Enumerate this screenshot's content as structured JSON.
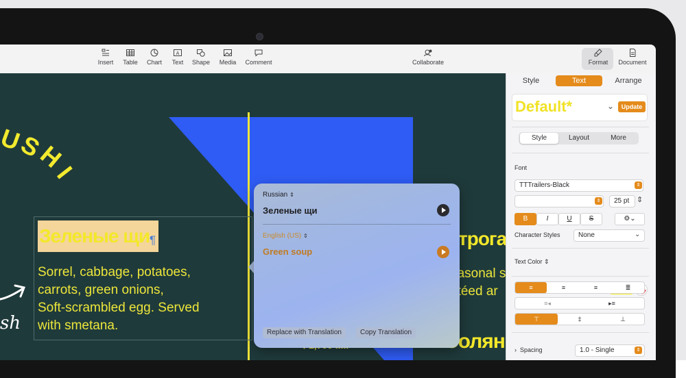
{
  "toolbar": {
    "items": [
      {
        "label": "Insert",
        "icon": "insert-icon"
      },
      {
        "label": "Table",
        "icon": "table-icon"
      },
      {
        "label": "Chart",
        "icon": "chart-icon"
      },
      {
        "label": "Text",
        "icon": "text-icon"
      },
      {
        "label": "Shape",
        "icon": "shape-icon"
      },
      {
        "label": "Media",
        "icon": "media-icon"
      },
      {
        "label": "Comment",
        "icon": "comment-icon"
      }
    ],
    "collaborate": "Collaborate",
    "format": "Format",
    "document": "Document"
  },
  "canvas": {
    "sushi_letters": [
      "U",
      "S",
      "H",
      "I"
    ],
    "heading": "Зеленые щи",
    "pilcrow": "¶",
    "body_lines": [
      "Sorrel, cabbage, potatoes,",
      "carrots, green onions,",
      "Soft-scrambled egg. Served",
      "with smetana."
    ],
    "price": "₽1,700 .....",
    "right_heading": "трога",
    "right_body_lines": [
      "easonal s",
      "utéed ar"
    ],
    "right_heading2": "Солян",
    "script_fragment": "sh",
    "colors": {
      "background": "#1f3a3b",
      "accent_yellow": "#f0e53a",
      "triangle_blue": "#2f5cf4"
    }
  },
  "translation_popover": {
    "source_language": "Russian",
    "source_text": "Зеленые щи",
    "target_language": "English (US)",
    "target_text": "Green soup",
    "replace_button": "Replace with Translation",
    "copy_button": "Copy Translation"
  },
  "inspector": {
    "tabs": [
      "Style",
      "Text",
      "Arrange"
    ],
    "active_tab": "Text",
    "paragraph_style": "Default*",
    "update_button": "Update",
    "subtabs": [
      "Style",
      "Layout",
      "More"
    ],
    "active_subtab": "Style",
    "font_label": "Font",
    "font_family": "TTTrailers-Black",
    "font_size": "25 pt",
    "format_buttons": [
      "B",
      "I",
      "U",
      "S"
    ],
    "character_styles_label": "Character Styles",
    "character_styles_value": "None",
    "text_color_label": "Text Color",
    "text_color": "#f7ee1f",
    "spacing_label": "Spacing",
    "spacing_value": "1.0 - Single",
    "accent_color": "#e48b1c"
  }
}
